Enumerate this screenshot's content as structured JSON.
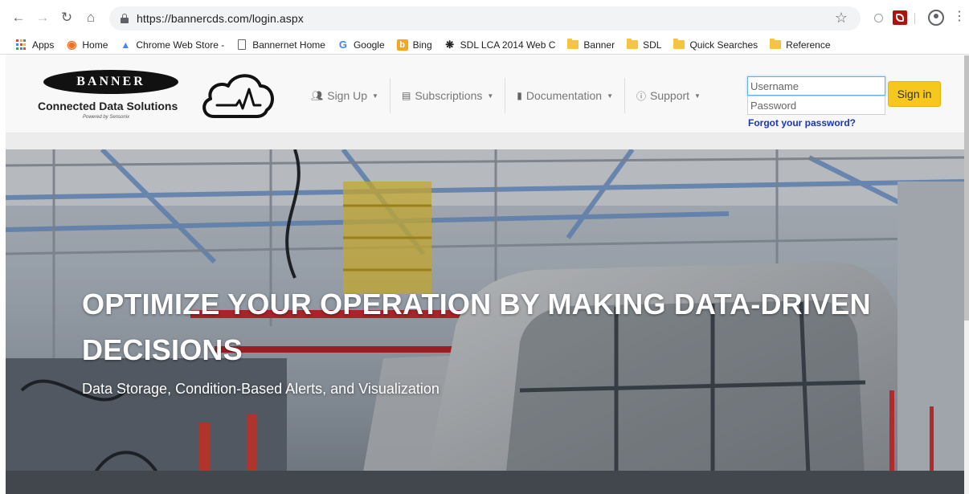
{
  "browser": {
    "url": "https://bannercds.com/login.aspx",
    "bookmarks": [
      {
        "label": "Apps",
        "icon": "apps-grid-icon"
      },
      {
        "label": "Home",
        "icon": "home-shield-icon"
      },
      {
        "label": "Chrome Web Store -",
        "icon": "chrome-web-store-icon"
      },
      {
        "label": "Bannernet Home",
        "icon": "page-icon"
      },
      {
        "label": "Google",
        "icon": "google-icon"
      },
      {
        "label": "Bing",
        "icon": "bing-icon"
      },
      {
        "label": "SDL LCA 2014 Web C",
        "icon": "sdl-icon"
      },
      {
        "label": "Banner",
        "icon": "folder-icon"
      },
      {
        "label": "SDL",
        "icon": "folder-icon"
      },
      {
        "label": "Quick Searches",
        "icon": "folder-icon"
      },
      {
        "label": "Reference",
        "icon": "folder-icon"
      }
    ]
  },
  "site": {
    "brand": {
      "logo_text": "BANNER",
      "tagline": "Connected Data Solutions",
      "powered_by": "Powered by Sensonix"
    },
    "nav": [
      {
        "label": "Sign Up",
        "icon": "user-plus-icon"
      },
      {
        "label": "Subscriptions",
        "icon": "credit-card-icon"
      },
      {
        "label": "Documentation",
        "icon": "book-icon"
      },
      {
        "label": "Support",
        "icon": "info-circle-icon"
      }
    ],
    "login": {
      "username_placeholder": "Username",
      "password_placeholder": "Password",
      "forgot_label": "Forgot your password?",
      "signin_label": "Sign in"
    },
    "hero": {
      "heading": "OPTIMIZE YOUR OPERATION BY MAKING DATA-DRIVEN DECISIONS",
      "subheading": "Data Storage, Condition-Based Alerts, and Visualization"
    }
  },
  "colors": {
    "signin_button": "#f6c71c",
    "forgot_link": "#1a35c4",
    "focus_border": "#66afe9"
  }
}
